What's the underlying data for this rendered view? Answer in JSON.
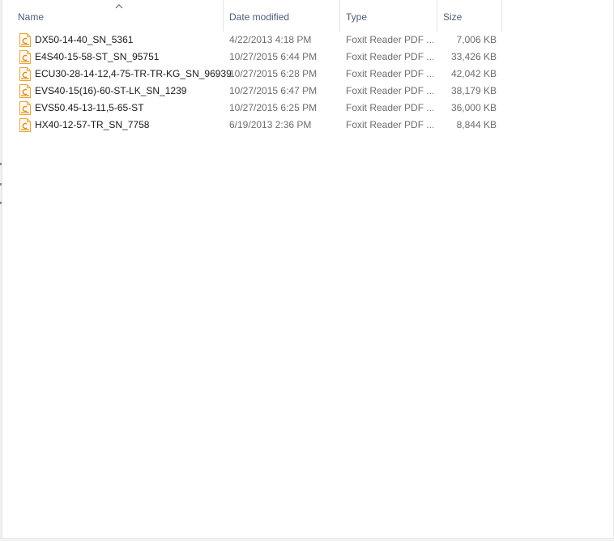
{
  "columns": {
    "name": "Name",
    "date_modified": "Date modified",
    "type": "Type",
    "size": "Size"
  },
  "files": [
    {
      "name": "DX50-14-40_SN_5361",
      "date_modified": "4/22/2013 4:18 PM",
      "type": "Foxit Reader PDF ...",
      "size": "7,006 KB",
      "icon": "foxit-pdf-icon"
    },
    {
      "name": "E4S40-15-58-ST_SN_95751",
      "date_modified": "10/27/2015 6:44 PM",
      "type": "Foxit Reader PDF ...",
      "size": "33,426 KB",
      "icon": "foxit-pdf-icon"
    },
    {
      "name": "ECU30-28-14-12,4-75-TR-TR-KG_SN_96939",
      "date_modified": "10/27/2015 6:28 PM",
      "type": "Foxit Reader PDF ...",
      "size": "42,042 KB",
      "icon": "foxit-pdf-icon"
    },
    {
      "name": "EVS40-15(16)-60-ST-LK_SN_1239",
      "date_modified": "10/27/2015 6:47 PM",
      "type": "Foxit Reader PDF ...",
      "size": "38,179 KB",
      "icon": "foxit-pdf-icon"
    },
    {
      "name": "EVS50.45-13-11,5-65-ST",
      "date_modified": "10/27/2015 6:25 PM",
      "type": "Foxit Reader PDF ...",
      "size": "36,000 KB",
      "icon": "foxit-pdf-icon"
    },
    {
      "name": "HX40-12-57-TR_SN_7758",
      "date_modified": "6/19/2013 2:36 PM",
      "type": "Foxit Reader PDF ...",
      "size": "8,844 KB",
      "icon": "foxit-pdf-icon"
    }
  ],
  "colors": {
    "header_text": "#4c607a",
    "detail_text": "#6d6d6d",
    "icon_accent": "#e8a33a"
  }
}
